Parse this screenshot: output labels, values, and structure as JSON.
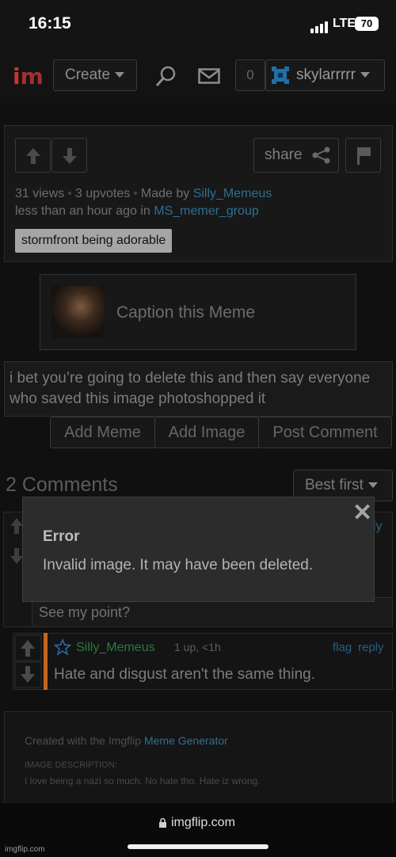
{
  "status_bar": {
    "time": "16:15",
    "network": "LTE",
    "battery": "70"
  },
  "nav": {
    "logo_i": "i",
    "logo_m": "m",
    "create_label": "Create",
    "notification_count": "0",
    "username": "skylarrrrr"
  },
  "post": {
    "share_label": "share",
    "views": "31 views",
    "upvotes": "3 upvotes",
    "made_by_prefix": "Made by",
    "author": "Silly_Memeus",
    "time_prefix": "less than an hour ago in",
    "stream": "MS_memer_group",
    "tag": "stormfront being adorable"
  },
  "caption": {
    "label": "Caption this Meme"
  },
  "comment_box": {
    "text": "i bet you’re going to delete this and then say everyone who saved this image photoshopped it",
    "add_meme": "Add Meme",
    "add_image": "Add Image",
    "post_comment": "Post Comment"
  },
  "comments": {
    "header": "2 Comments",
    "sort": "Best first",
    "partial_reply": "ply",
    "see_point": "See my point?",
    "reply": {
      "username": "Silly_Memeus",
      "meta": "1 up, <1h",
      "flag": "flag",
      "reply": "reply",
      "text": "Hate and disgust aren't the same thing."
    }
  },
  "modal": {
    "close": "✕",
    "title": "Error",
    "message": "Invalid image. It may have been deleted."
  },
  "footer": {
    "created_prefix": "Created with the Imgflip",
    "generator": "Meme Generator",
    "desc_label": "IMAGE DESCRIPTION:",
    "desc": "I love being a nazi so much. No hate tho. Hate iz wrong."
  },
  "browser": {
    "url": "imgflip.com"
  },
  "watermark": "imgflip.com",
  "colors": {
    "link": "#2f6f8e",
    "accent_orange": "#c6651e",
    "logo_red": "#c0392b",
    "username_green": "#2a7a3a"
  }
}
